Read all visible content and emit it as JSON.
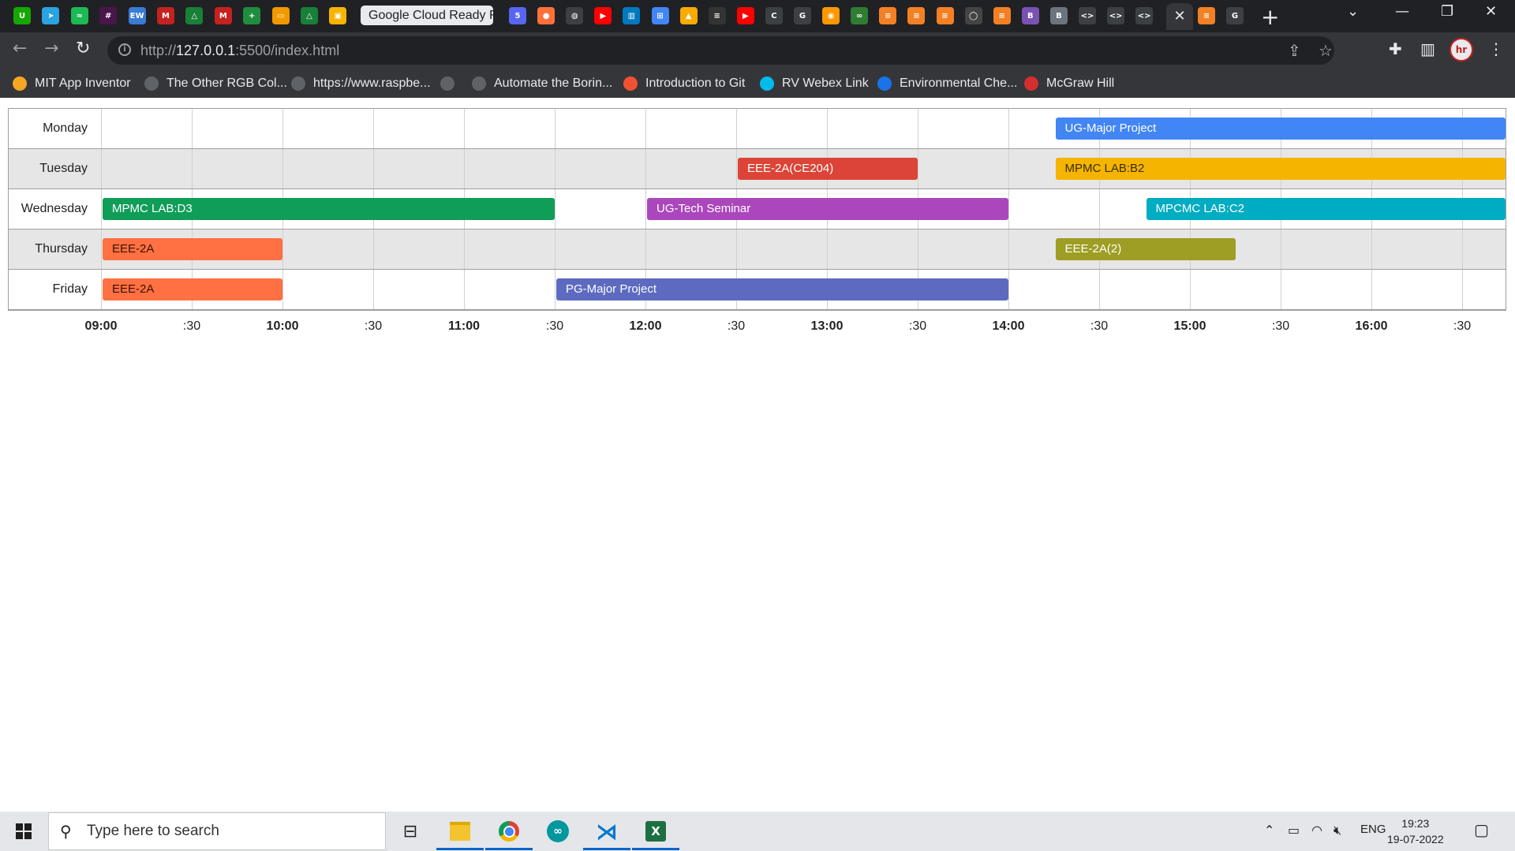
{
  "browser": {
    "active_tab_title": "Google Cloud Ready F",
    "tab_close": "✕",
    "new_tab": "+",
    "url_scheme": "http://",
    "url_host": "127.0.0.1",
    "url_rest": ":5500/index.html",
    "profile_initials": "hr",
    "tab_icons": [
      {
        "icon": "upwork-icon",
        "color": "#14a800",
        "glyph": "U"
      },
      {
        "icon": "telegram-icon",
        "color": "#2aa3e0",
        "glyph": "➤"
      },
      {
        "icon": "spotify-icon",
        "color": "#1db954",
        "glyph": "≈"
      },
      {
        "icon": "slack-icon",
        "color": "#4a154b",
        "glyph": "#"
      },
      {
        "icon": "ew-icon",
        "color": "#3a7bd5",
        "glyph": "EW"
      },
      {
        "icon": "gmail-icon",
        "color": "#c5221f",
        "glyph": "M"
      },
      {
        "icon": "drive-icon",
        "color": "#188038",
        "glyph": "△"
      },
      {
        "icon": "gmail-icon",
        "color": "#c5221f",
        "glyph": "M"
      },
      {
        "icon": "sheets-plus-icon",
        "color": "#1e8e3e",
        "glyph": "+"
      },
      {
        "icon": "slides-icon",
        "color": "#f29900",
        "glyph": "▭"
      },
      {
        "icon": "drive-icon",
        "color": "#188038",
        "glyph": "△"
      },
      {
        "icon": "classroom-icon",
        "color": "#f4b400",
        "glyph": "▣"
      }
    ],
    "tab_icons_right": [
      {
        "icon": "reddit-badge-icon",
        "color": "#5865f2",
        "glyph": "5"
      },
      {
        "icon": "firefox-icon",
        "color": "#ff7139",
        "glyph": "●"
      },
      {
        "icon": "globe-icon",
        "color": "#e8eaed",
        "glyph": "◍"
      },
      {
        "icon": "youtube-icon",
        "color": "#ff0000",
        "glyph": "▶"
      },
      {
        "icon": "trello-icon",
        "color": "#0079bf",
        "glyph": "▥"
      },
      {
        "icon": "app-icon",
        "color": "#4285f4",
        "glyph": "⊞"
      },
      {
        "icon": "fire-icon",
        "color": "#f9ab00",
        "glyph": "▲"
      },
      {
        "icon": "swm-icon",
        "color": "#333333",
        "glyph": "≡"
      },
      {
        "icon": "youtube-icon",
        "color": "#ff0000",
        "glyph": "▶"
      },
      {
        "icon": "c-icon",
        "color": "#ffffff",
        "glyph": "C"
      },
      {
        "icon": "google-icon",
        "color": "#ffffff",
        "glyph": "G"
      },
      {
        "icon": "orange-icon",
        "color": "#ff9800",
        "glyph": "◉"
      },
      {
        "icon": "glasses-icon",
        "color": "#2e7d32",
        "glyph": "∞"
      },
      {
        "icon": "stackoverflow-icon",
        "color": "#f48024",
        "glyph": "≡"
      },
      {
        "icon": "stackoverflow-icon",
        "color": "#f48024",
        "glyph": "≡"
      },
      {
        "icon": "stackoverflow-icon",
        "color": "#f48024",
        "glyph": "≡"
      },
      {
        "icon": "github-icon",
        "color": "#444444",
        "glyph": "◯"
      },
      {
        "icon": "stackoverflow-icon",
        "color": "#f48024",
        "glyph": "≡"
      },
      {
        "icon": "bootstrap-icon",
        "color": "#7952b3",
        "glyph": "B"
      },
      {
        "icon": "bootstrap-icon",
        "color": "#6c757d",
        "glyph": "B"
      },
      {
        "icon": "code-icon",
        "color": "#ffffff",
        "glyph": "<>"
      },
      {
        "icon": "code-icon",
        "color": "#ffffff",
        "glyph": "<>"
      },
      {
        "icon": "code-icon",
        "color": "#ffffff",
        "glyph": "<>"
      }
    ],
    "tab_icons_after": [
      {
        "icon": "stackoverflow-icon",
        "color": "#f48024",
        "glyph": "≡"
      },
      {
        "icon": "google-icon",
        "color": "#ffffff",
        "glyph": "G"
      }
    ]
  },
  "bookmarks": [
    {
      "label": "MIT App Inventor",
      "icon": "app-inventor-icon",
      "color": "#f5a623"
    },
    {
      "label": "The Other RGB Col...",
      "icon": "globe-icon",
      "color": "#5f6368"
    },
    {
      "label": "https://www.raspbe...",
      "icon": "globe-icon",
      "color": "#5f6368"
    },
    {
      "label": "",
      "icon": "globe-icon",
      "color": "#5f6368"
    },
    {
      "label": "Automate the Borin...",
      "icon": "globe-icon",
      "color": "#5f6368"
    },
    {
      "label": "Introduction to Git",
      "icon": "git-icon",
      "color": "#f05133"
    },
    {
      "label": "RV Webex Link",
      "icon": "webex-icon",
      "color": "#00bceb"
    },
    {
      "label": "Environmental Che...",
      "icon": "document-icon",
      "color": "#1a73e8"
    },
    {
      "label": "McGraw Hill",
      "icon": "mcgraw-hill-icon",
      "color": "#d32f2f"
    }
  ],
  "chart_data": {
    "type": "timeline",
    "rows": [
      "Monday",
      "Tuesday",
      "Wednesday",
      "Thursday",
      "Friday"
    ],
    "x_ticks": [
      "09:00",
      ":30",
      "10:00",
      ":30",
      "11:00",
      ":30",
      "12:00",
      ":30",
      "13:00",
      ":30",
      "14:00",
      ":30",
      "15:00",
      ":30",
      "16:00",
      ":30"
    ],
    "x_range": [
      "09:00",
      "16:45"
    ],
    "grid": true,
    "events": [
      {
        "row": "Monday",
        "label": "UG-Major Project",
        "start": "14:15",
        "end": "16:45",
        "color": "#4285f4",
        "text_color": "#ffffff"
      },
      {
        "row": "Tuesday",
        "label": "EEE-2A(CE204)",
        "start": "12:30",
        "end": "13:30",
        "color": "#db4437",
        "text_color": "#ffffff"
      },
      {
        "row": "Tuesday",
        "label": "MPMC LAB:B2",
        "start": "14:15",
        "end": "16:45",
        "color": "#f4b400",
        "text_color": "#3a2e00"
      },
      {
        "row": "Wednesday",
        "label": "MPMC LAB:D3",
        "start": "09:00",
        "end": "11:30",
        "color": "#0f9d58",
        "text_color": "#ffffff"
      },
      {
        "row": "Wednesday",
        "label": "UG-Tech Seminar",
        "start": "12:00",
        "end": "14:00",
        "color": "#ab47bc",
        "text_color": "#ffffff"
      },
      {
        "row": "Wednesday",
        "label": "MPCMC LAB:C2",
        "start": "14:45",
        "end": "16:45",
        "color": "#00acc1",
        "text_color": "#ffffff"
      },
      {
        "row": "Thursday",
        "label": "EEE-2A",
        "start": "09:00",
        "end": "10:00",
        "color": "#ff7043",
        "text_color": "#3a1200"
      },
      {
        "row": "Thursday",
        "label": "EEE-2A(2)",
        "start": "14:15",
        "end": "15:15",
        "color": "#9e9d24",
        "text_color": "#ffffff"
      },
      {
        "row": "Friday",
        "label": "EEE-2A",
        "start": "09:00",
        "end": "10:00",
        "color": "#ff7043",
        "text_color": "#3a1200"
      },
      {
        "row": "Friday",
        "label": "PG-Major Project",
        "start": "11:30",
        "end": "14:00",
        "color": "#5c6bc0",
        "text_color": "#ffffff"
      }
    ]
  },
  "taskbar": {
    "search_placeholder": "Type here to search",
    "language": "ENG",
    "time": "19:23",
    "date": "19-07-2022"
  }
}
